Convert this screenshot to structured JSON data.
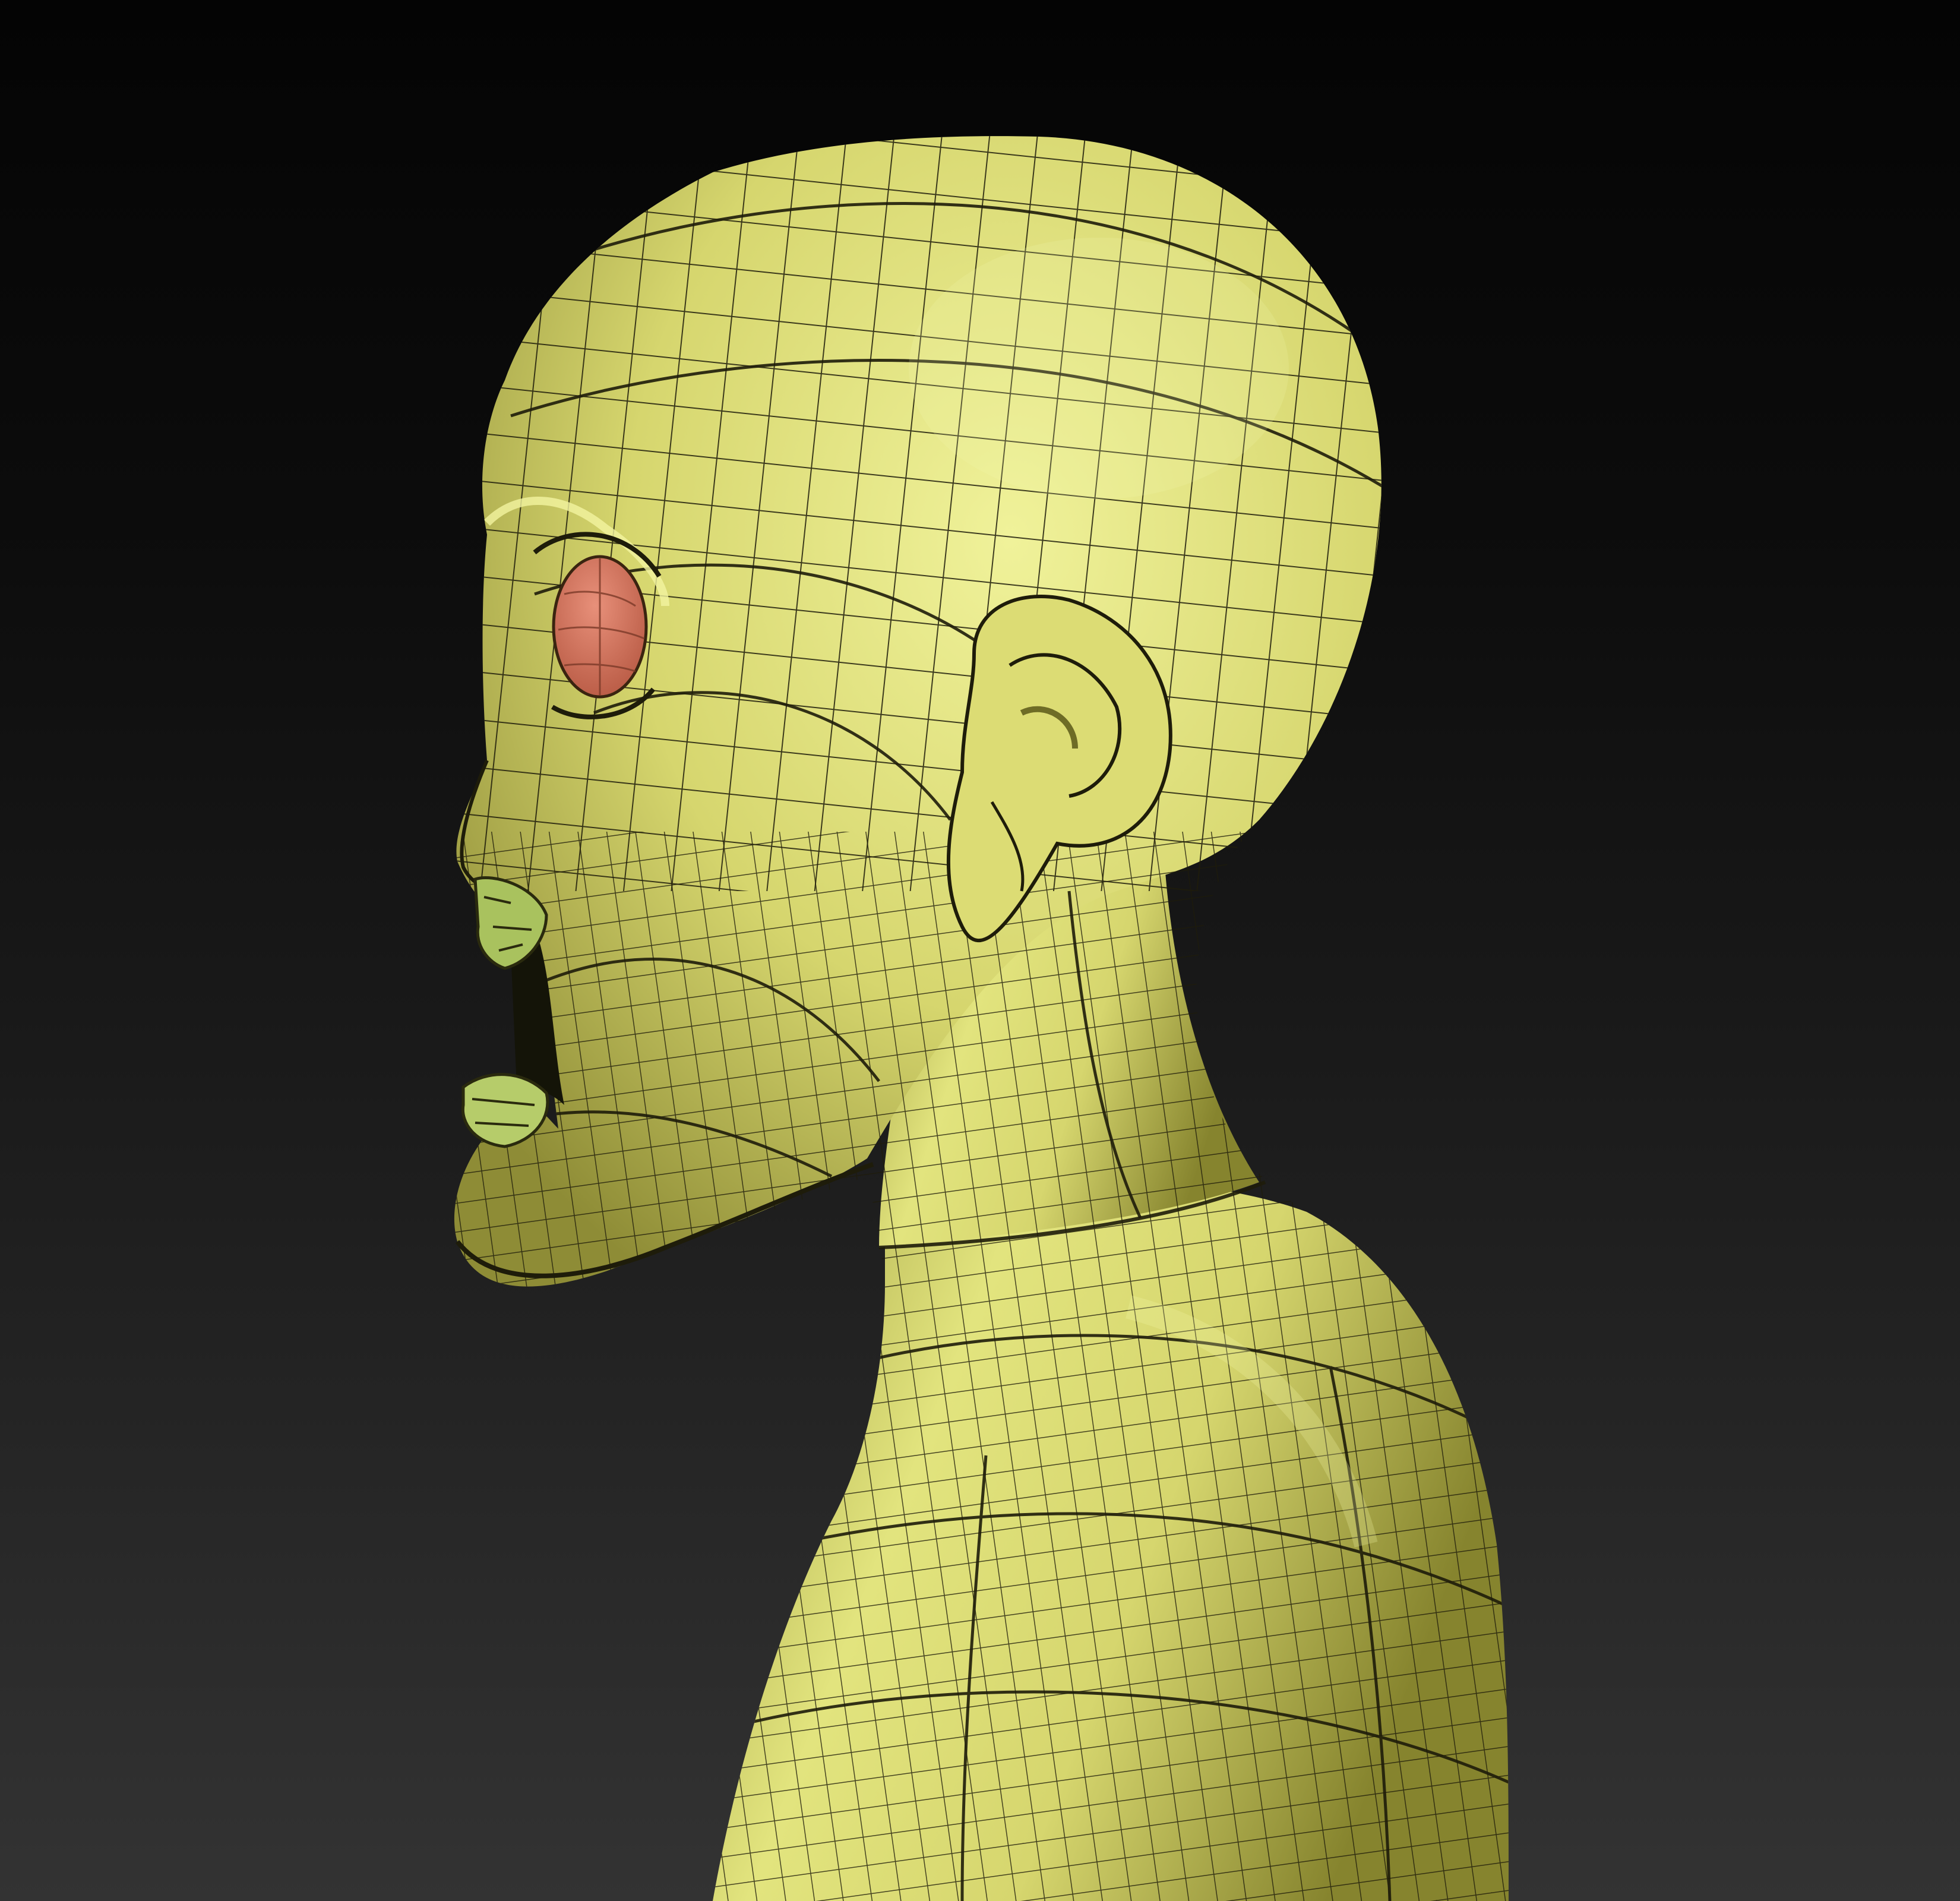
{
  "viewport": {
    "background_top": "#040404",
    "background_bottom": "#333333"
  },
  "model": {
    "material_color": "#cfd06a",
    "highlight_color": "#eef090",
    "shadow_color": "#8e8c36",
    "wire_color": "#1e1c0a",
    "eye_color": "#d2745c",
    "lip_color": "#a9c25e",
    "display": "polyframe"
  }
}
